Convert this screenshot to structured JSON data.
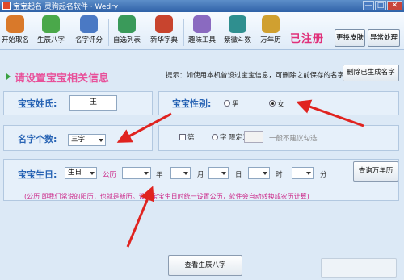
{
  "window": {
    "title": "宝宝起名  灵狗起名软件  · Wedry",
    "min": "—",
    "max": "□",
    "close": "✕"
  },
  "toolbar": {
    "items": [
      {
        "label": "开始取名",
        "icon": "horse-icon",
        "color": "#d9792a"
      },
      {
        "label": "生辰八字",
        "icon": "people-icon",
        "color": "#4aa84a"
      },
      {
        "label": "名字评分",
        "icon": "chart-icon",
        "color": "#4a79c4"
      },
      {
        "label": "自选列表",
        "icon": "list-icon",
        "color": "#3a9a5a"
      },
      {
        "label": "新华字典",
        "icon": "book-icon",
        "color": "#c8442e"
      },
      {
        "label": "趣味工具",
        "icon": "tools-icon",
        "color": "#8a6ac0"
      },
      {
        "label": "紫微斗数",
        "icon": "star-icon",
        "color": "#2f8f8f"
      },
      {
        "label": "万年历",
        "icon": "calendar-icon",
        "color": "#d0a030"
      }
    ],
    "register": "已注册",
    "skin_button": "更换皮肤",
    "exit_button": "异常处理"
  },
  "header": {
    "section_title": "请设置宝宝相关信息",
    "tip": "提示：如使用本机曾设过宝宝信息，可删除之前保存的名字!",
    "delete_button": "删除已生成名字"
  },
  "form": {
    "surname_label": "宝宝姓氏:",
    "surname_value": "王",
    "gender_label": "宝宝性别:",
    "gender_options": [
      "男",
      "女"
    ],
    "gender_selected": "女",
    "count_label": "名字个数:",
    "count_value": "三字",
    "fixed_checkbox": "第",
    "fixed_radio": "字",
    "fixed_label": "限定为",
    "fixed_hint": "一般不建议勾选",
    "birth_label": "宝宝生日:",
    "calendar_type": "生日",
    "calendar_mode": "公历",
    "year_unit": "年",
    "month_unit": "月",
    "day_unit": "日",
    "hour_unit": "时",
    "minute_unit": "分",
    "lunar_button": "查询万年历",
    "note": "(公历  即我们常说的阳历，也就是新历。设置宝宝生日时统一设置公历，软件会自动转换成农历计算)",
    "bazi_button": "查看生辰八字"
  },
  "colors": {
    "accent": "#2763b4",
    "pink": "#e8519a",
    "arrow": "#e0231f"
  }
}
